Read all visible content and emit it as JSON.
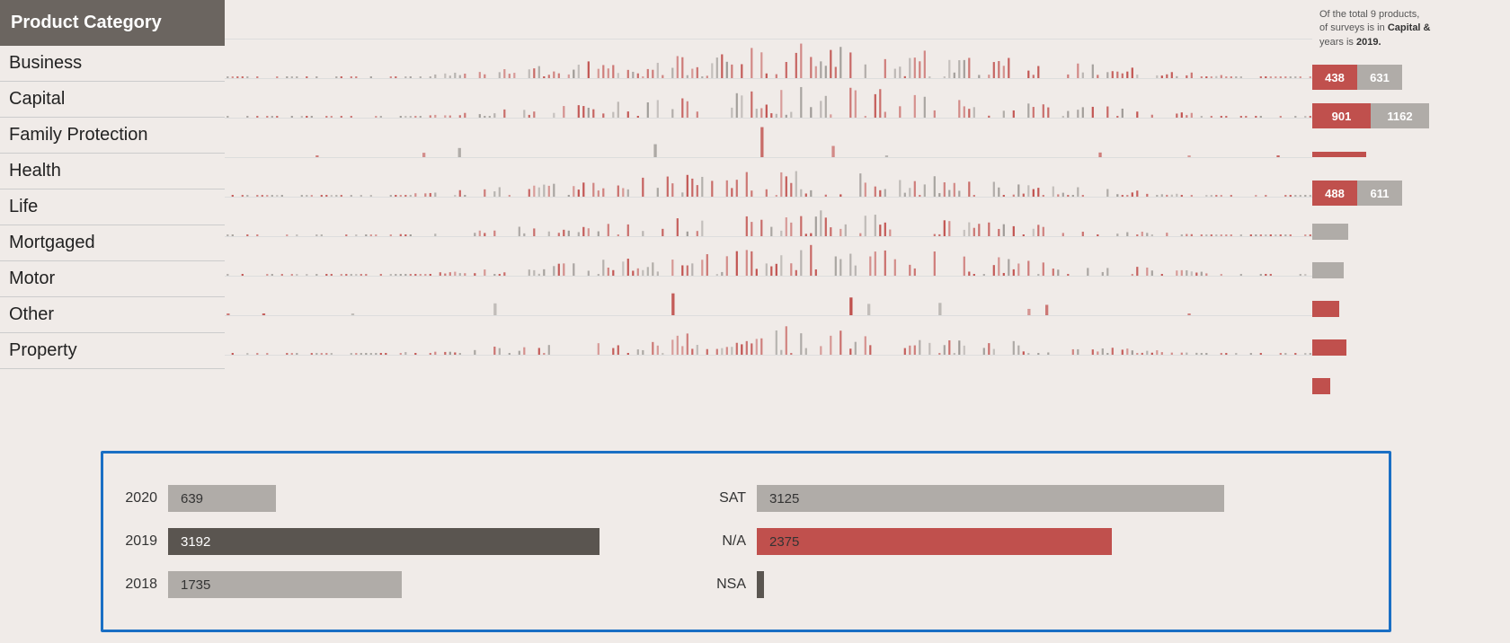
{
  "header": {
    "title": "Product Category"
  },
  "categories": [
    {
      "label": "Business"
    },
    {
      "label": "Capital"
    },
    {
      "label": "Family Protection"
    },
    {
      "label": "Health"
    },
    {
      "label": "Life"
    },
    {
      "label": "Mortgaged"
    },
    {
      "label": "Motor"
    },
    {
      "label": "Other"
    },
    {
      "label": "Property"
    }
  ],
  "topText": {
    "line1": "Of the total 9 products,",
    "line2": "of surveys is in Capital &",
    "line3": "years is",
    "year": "2019."
  },
  "stats": [
    {
      "left": "438",
      "right": "631",
      "showBars": true
    },
    {
      "left": "901",
      "right": "1162",
      "showBars": true
    },
    {
      "left": null,
      "right": null,
      "showBars": false,
      "singleColor": "none"
    },
    {
      "left": "488",
      "right": "611",
      "showBars": true
    },
    {
      "left": null,
      "right": null,
      "showBars": false,
      "singleColor": "gray"
    },
    {
      "left": null,
      "right": null,
      "showBars": false,
      "singleColor": "gray"
    },
    {
      "left": null,
      "right": null,
      "showBars": false,
      "singleColor": "red"
    },
    {
      "left": null,
      "right": null,
      "showBars": false,
      "singleColor": "red"
    },
    {
      "left": null,
      "right": null,
      "showBars": false,
      "singleColor": "red"
    }
  ],
  "yearBars": [
    {
      "year": "2020",
      "value": 639,
      "maxVal": 3192,
      "color": "#b0aca8"
    },
    {
      "year": "2019",
      "value": 3192,
      "maxVal": 3192,
      "color": "#5a5550"
    },
    {
      "year": "2018",
      "value": 1735,
      "maxVal": 3192,
      "color": "#b0aca8"
    }
  ],
  "satBars": [
    {
      "label": "SAT",
      "value": 3125,
      "maxVal": 3125,
      "color": "#b0aca8"
    },
    {
      "label": "N/A",
      "value": 2375,
      "maxVal": 3125,
      "color": "#c0504d"
    },
    {
      "label": "NSA",
      "value": 30,
      "maxVal": 3125,
      "color": "#5a5550"
    }
  ]
}
